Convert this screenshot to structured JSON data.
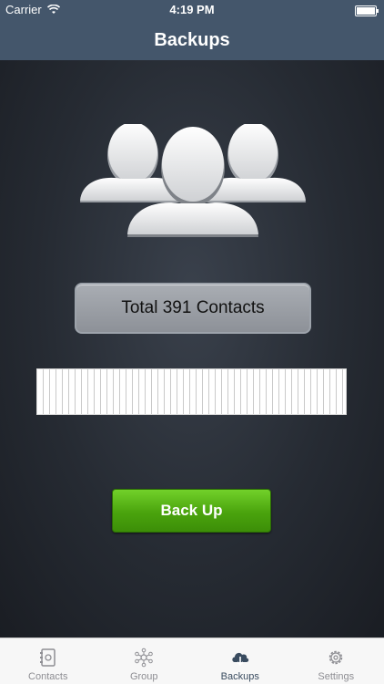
{
  "status_bar": {
    "carrier": "Carrier",
    "time": "4:19 PM"
  },
  "nav": {
    "title": "Backups"
  },
  "main": {
    "total_label": "Total 391 Contacts",
    "backup_button_label": "Back Up",
    "progress_fraction": 0.0
  },
  "tabs": [
    {
      "label": "Contacts",
      "icon": "contacts-book-icon",
      "active": false
    },
    {
      "label": "Group",
      "icon": "group-network-icon",
      "active": false
    },
    {
      "label": "Backups",
      "icon": "cloud-download-icon",
      "active": true
    },
    {
      "label": "Settings",
      "icon": "gear-icon",
      "active": false
    }
  ],
  "colors": {
    "nav_background": "#44566b",
    "button_green": "#4aa30d",
    "tab_active": "#394b5f",
    "tab_inactive": "#8e8e93"
  }
}
